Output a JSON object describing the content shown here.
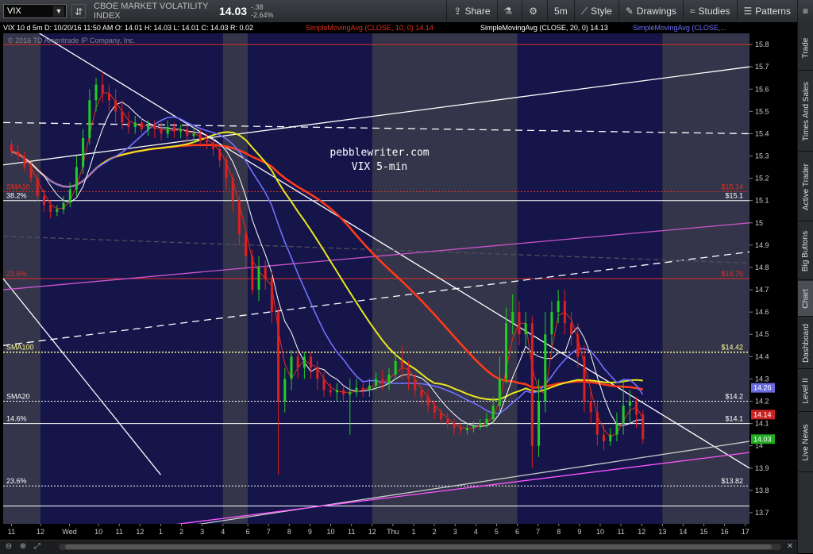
{
  "toolbar": {
    "symbol": "VIX",
    "company": "CBOE MARKET VOLATILITY INDEX",
    "price": "14.03",
    "change": "-.38",
    "change_pct": "-2.64%",
    "share": "Share",
    "timeframe": "5m",
    "style": "Style",
    "drawings": "Drawings",
    "studies": "Studies",
    "patterns": "Patterns"
  },
  "sidebar": {
    "tabs": [
      "Trade",
      "Times And Sales",
      "Active Trader",
      "Big Buttons",
      "Chart",
      "Dashboard",
      "Level II",
      "Live News"
    ]
  },
  "chart_data": {
    "type": "candlestick",
    "header_readout": "VIX 10 d 5m   D: 10/20/16 11:50 AM  O: 14.01  H: 14.03  L: 14.01  C: 14.03  R: 0.02",
    "copyright": "© 2016 TD Ameritrade IP Company, Inc.",
    "legend": [
      {
        "name": "SimpleMovingAvg (CLOSE, 10, 0)",
        "value": "14.14",
        "color": "#e03020"
      },
      {
        "name": "SimpleMovingAvg (CLOSE, 20, 0)",
        "value": "14.13",
        "color": "#ffffff"
      },
      {
        "name": "SimpleMovingAvg (CLOSE,...",
        "value": "",
        "color": "#7070ff"
      }
    ],
    "ylim": [
      13.65,
      15.9
    ],
    "yticks": [
      13.7,
      13.8,
      13.9,
      14.0,
      14.1,
      14.2,
      14.3,
      14.4,
      14.5,
      14.6,
      14.7,
      14.8,
      14.9,
      15.0,
      15.1,
      15.2,
      15.3,
      15.4,
      15.5,
      15.6,
      15.7,
      15.8
    ],
    "ytick_labels": [
      "13.7",
      "13.8",
      "13.9",
      "14",
      "14.1",
      "14.2",
      "14.3",
      "14.4",
      "14.5",
      "14.6",
      "14.7",
      "14.8",
      "14.9",
      "15",
      "15.1",
      "15.2",
      "15.3",
      "15.4",
      "15.5",
      "15.6",
      "15.7",
      "15.8"
    ],
    "x_range": [
      0,
      180
    ],
    "xticks": [
      {
        "x": 2,
        "label": "11"
      },
      {
        "x": 9,
        "label": "12"
      },
      {
        "x": 16,
        "label": "Wed"
      },
      {
        "x": 23,
        "label": "10"
      },
      {
        "x": 28,
        "label": "11"
      },
      {
        "x": 33,
        "label": "12"
      },
      {
        "x": 38,
        "label": "1"
      },
      {
        "x": 43,
        "label": "2"
      },
      {
        "x": 48,
        "label": "3"
      },
      {
        "x": 53,
        "label": "4"
      },
      {
        "x": 59,
        "label": "6"
      },
      {
        "x": 64,
        "label": "7"
      },
      {
        "x": 69,
        "label": "8"
      },
      {
        "x": 74,
        "label": "9"
      },
      {
        "x": 79,
        "label": "10"
      },
      {
        "x": 84,
        "label": "11"
      },
      {
        "x": 89,
        "label": "12"
      },
      {
        "x": 94,
        "label": "Thu"
      },
      {
        "x": 99,
        "label": "1"
      },
      {
        "x": 104,
        "label": "2"
      },
      {
        "x": 109,
        "label": "3"
      },
      {
        "x": 114,
        "label": "4"
      },
      {
        "x": 119,
        "label": "5"
      },
      {
        "x": 124,
        "label": "6"
      },
      {
        "x": 129,
        "label": "7"
      },
      {
        "x": 134,
        "label": "8"
      },
      {
        "x": 139,
        "label": "9"
      },
      {
        "x": 144,
        "label": "10"
      },
      {
        "x": 149,
        "label": "11"
      },
      {
        "x": 154,
        "label": "12"
      },
      {
        "x": 159,
        "label": "13"
      },
      {
        "x": 164,
        "label": "14"
      },
      {
        "x": 169,
        "label": "15"
      },
      {
        "x": 174,
        "label": "16"
      },
      {
        "x": 179,
        "label": "17"
      }
    ],
    "sessions": [
      {
        "from": 0,
        "to": 9,
        "shade": "light"
      },
      {
        "from": 9,
        "to": 53,
        "shade": "dark"
      },
      {
        "from": 53,
        "to": 59,
        "shade": "light"
      },
      {
        "from": 59,
        "to": 89,
        "shade": "dark"
      },
      {
        "from": 89,
        "to": 124,
        "shade": "light"
      },
      {
        "from": 124,
        "to": 159,
        "shade": "dark"
      },
      {
        "from": 159,
        "to": 180,
        "shade": "light"
      }
    ],
    "annotation": [
      "pebblewriter.com",
      "VIX 5-min"
    ],
    "hlines": [
      {
        "y": 15.8,
        "color": "#e03020",
        "style": "solid",
        "label": "",
        "price_label": ""
      },
      {
        "y": 15.14,
        "color": "#e03020",
        "style": "dotted",
        "label": "SMA10",
        "price_label": "$15.14"
      },
      {
        "y": 15.1,
        "color": "#ffffff",
        "style": "solid",
        "label": "38.2%",
        "price_label": "$15.1"
      },
      {
        "y": 14.75,
        "color": "#e03020",
        "style": "solid",
        "label": "23.6%",
        "price_label": "$14.75"
      },
      {
        "y": 14.42,
        "color": "#ffff99",
        "style": "dotted",
        "label": "SMA100",
        "price_label": "$14.42"
      },
      {
        "y": 14.2,
        "color": "#ffffff",
        "style": "dotted",
        "label": "SMA20",
        "price_label": "$14.2"
      },
      {
        "y": 14.1,
        "color": "#ffffff",
        "style": "solid",
        "label": "14.6%",
        "price_label": "$14.1"
      },
      {
        "y": 13.82,
        "color": "#ffffff",
        "style": "dotted",
        "label": "23.6%",
        "price_label": "$13.82"
      },
      {
        "y": 13.73,
        "color": "#ffffff",
        "style": "solid",
        "label": "",
        "price_label": ""
      }
    ],
    "trendlines": [
      {
        "x1": 0,
        "y1": 15.95,
        "x2": 180,
        "y2": 13.9,
        "color": "#ffffff",
        "dash": ""
      },
      {
        "x1": 0,
        "y1": 14.75,
        "x2": 38,
        "y2": 13.87,
        "color": "#ffffff",
        "dash": ""
      },
      {
        "x1": 0,
        "y1": 15.26,
        "x2": 180,
        "y2": 15.7,
        "color": "#ffffff",
        "dash": ""
      },
      {
        "x1": 0,
        "y1": 15.45,
        "x2": 180,
        "y2": 15.4,
        "color": "#ffffff",
        "dash": "9,6"
      },
      {
        "x1": 0,
        "y1": 14.45,
        "x2": 180,
        "y2": 14.87,
        "color": "#ffffff",
        "dash": "9,6"
      },
      {
        "x1": 0,
        "y1": 14.94,
        "x2": 180,
        "y2": 14.82,
        "color": "#505060",
        "dash": "6,4"
      },
      {
        "x1": 0,
        "y1": 14.7,
        "x2": 180,
        "y2": 15.0,
        "color": "#cc55cc",
        "dash": ""
      },
      {
        "x1": 30,
        "y1": 13.6,
        "x2": 180,
        "y2": 14.02,
        "color": "#cccccc",
        "dash": ""
      },
      {
        "x1": 34,
        "y1": 13.63,
        "x2": 180,
        "y2": 13.97,
        "color": "#ff55ff",
        "dash": ""
      }
    ],
    "candles": [
      [
        0,
        15.35,
        15.32,
        15.37,
        15.3
      ],
      [
        1,
        15.32,
        15.3,
        15.35,
        15.28
      ],
      [
        2,
        15.3,
        15.25,
        15.32,
        15.23
      ],
      [
        3,
        15.25,
        15.2,
        15.27,
        15.18
      ],
      [
        4,
        15.2,
        15.12,
        15.22,
        15.1
      ],
      [
        5,
        15.12,
        15.08,
        15.15,
        15.05
      ],
      [
        6,
        15.08,
        15.05,
        15.1,
        15.02
      ],
      [
        7,
        15.05,
        15.06,
        15.08,
        15.03
      ],
      [
        8,
        15.06,
        15.09,
        15.12,
        15.04
      ],
      [
        9,
        15.09,
        15.15,
        15.18,
        15.07
      ],
      [
        10,
        15.15,
        15.25,
        15.3,
        15.12
      ],
      [
        11,
        15.25,
        15.38,
        15.42,
        15.22
      ],
      [
        12,
        15.38,
        15.55,
        15.6,
        15.35
      ],
      [
        13,
        15.55,
        15.62,
        15.65,
        15.5
      ],
      [
        14,
        15.62,
        15.58,
        15.68,
        15.54
      ],
      [
        15,
        15.58,
        15.55,
        15.62,
        15.5
      ],
      [
        16,
        15.55,
        15.5,
        15.6,
        15.45
      ],
      [
        17,
        15.5,
        15.45,
        15.55,
        15.42
      ],
      [
        18,
        15.45,
        15.43,
        15.5,
        15.4
      ],
      [
        19,
        15.43,
        15.45,
        15.48,
        15.4
      ],
      [
        20,
        15.45,
        15.42,
        15.47,
        15.4
      ],
      [
        21,
        15.42,
        15.44,
        15.46,
        15.39
      ],
      [
        22,
        15.44,
        15.42,
        15.46,
        15.38
      ],
      [
        23,
        15.42,
        15.4,
        15.45,
        15.37
      ],
      [
        24,
        15.4,
        15.43,
        15.46,
        15.38
      ],
      [
        25,
        15.43,
        15.41,
        15.45,
        15.38
      ],
      [
        26,
        15.41,
        15.42,
        15.44,
        15.38
      ],
      [
        27,
        15.42,
        15.39,
        15.44,
        15.36
      ],
      [
        28,
        15.39,
        15.4,
        15.43,
        15.36
      ],
      [
        29,
        15.4,
        15.37,
        15.42,
        15.34
      ],
      [
        30,
        15.37,
        15.36,
        15.4,
        15.33
      ],
      [
        31,
        15.36,
        15.33,
        15.38,
        15.3
      ],
      [
        32,
        15.33,
        15.28,
        15.35,
        15.25
      ],
      [
        33,
        15.28,
        15.2,
        15.3,
        15.15
      ],
      [
        34,
        15.2,
        15.1,
        15.22,
        15.05
      ],
      [
        35,
        15.1,
        14.95,
        15.12,
        14.9
      ],
      [
        36,
        14.95,
        14.85,
        14.98,
        14.8
      ],
      [
        37,
        14.85,
        14.7,
        14.88,
        14.68
      ],
      [
        38,
        14.7,
        14.8,
        14.85,
        14.65
      ],
      [
        39,
        14.8,
        14.75,
        14.83,
        14.7
      ],
      [
        40,
        14.75,
        14.6,
        14.78,
        14.55
      ],
      [
        41,
        14.6,
        14.2,
        14.62,
        13.87
      ],
      [
        42,
        14.2,
        14.3,
        14.35,
        14.15
      ],
      [
        43,
        14.3,
        14.4,
        14.43,
        14.25
      ],
      [
        44,
        14.4,
        14.35,
        14.43,
        14.3
      ],
      [
        45,
        14.35,
        14.4,
        14.42,
        14.3
      ],
      [
        46,
        14.4,
        14.35,
        14.42,
        14.3
      ],
      [
        47,
        14.35,
        14.3,
        14.38,
        14.25
      ],
      [
        48,
        14.3,
        14.25,
        14.33,
        14.22
      ],
      [
        49,
        14.25,
        14.24,
        14.28,
        14.22
      ],
      [
        50,
        14.24,
        14.25,
        14.28,
        14.2
      ],
      [
        51,
        14.25,
        14.23,
        14.27,
        14.2
      ],
      [
        52,
        14.23,
        14.24,
        14.3,
        14.05
      ],
      [
        53,
        14.24,
        14.26,
        14.3,
        14.22
      ],
      [
        54,
        14.26,
        14.25,
        14.28,
        14.22
      ],
      [
        55,
        14.25,
        14.27,
        14.3,
        14.22
      ],
      [
        56,
        14.27,
        14.3,
        14.33,
        14.25
      ],
      [
        57,
        14.3,
        14.28,
        14.34,
        14.25
      ],
      [
        58,
        14.28,
        14.32,
        14.35,
        14.25
      ],
      [
        59,
        14.32,
        14.38,
        14.42,
        14.3
      ],
      [
        60,
        14.38,
        14.35,
        14.45,
        14.3
      ],
      [
        61,
        14.35,
        14.3,
        14.38,
        14.25
      ],
      [
        62,
        14.3,
        14.25,
        14.32,
        14.22
      ],
      [
        63,
        14.25,
        14.22,
        14.27,
        14.18
      ],
      [
        64,
        14.22,
        14.18,
        14.25,
        14.15
      ],
      [
        65,
        14.18,
        14.15,
        14.2,
        14.12
      ],
      [
        66,
        14.15,
        14.12,
        14.17,
        14.1
      ],
      [
        67,
        14.12,
        14.1,
        14.15,
        14.08
      ],
      [
        68,
        14.1,
        14.08,
        14.12,
        14.05
      ],
      [
        69,
        14.08,
        14.07,
        14.1,
        14.05
      ],
      [
        70,
        14.07,
        14.08,
        14.1,
        14.05
      ],
      [
        71,
        14.08,
        14.09,
        14.11,
        14.06
      ],
      [
        72,
        14.09,
        14.1,
        14.12,
        14.07
      ],
      [
        73,
        14.1,
        14.12,
        14.15,
        14.08
      ],
      [
        74,
        14.12,
        14.18,
        14.22,
        14.1
      ],
      [
        75,
        14.18,
        14.3,
        14.4,
        14.15
      ],
      [
        76,
        14.3,
        14.55,
        14.62,
        14.28
      ],
      [
        77,
        14.55,
        14.6,
        14.68,
        14.5
      ],
      [
        78,
        14.6,
        14.5,
        14.65,
        14.45
      ],
      [
        79,
        14.5,
        14.55,
        14.6,
        14.45
      ],
      [
        80,
        14.55,
        14.0,
        14.58,
        13.9
      ],
      [
        81,
        14.0,
        14.2,
        14.3,
        13.95
      ],
      [
        82,
        14.2,
        14.5,
        14.6,
        14.15
      ],
      [
        83,
        14.5,
        14.6,
        14.65,
        14.45
      ],
      [
        84,
        14.6,
        14.65,
        14.7,
        14.55
      ],
      [
        85,
        14.65,
        14.55,
        14.7,
        14.5
      ],
      [
        86,
        14.55,
        14.5,
        14.6,
        14.45
      ],
      [
        87,
        14.5,
        14.4,
        14.55,
        14.35
      ],
      [
        88,
        14.4,
        14.2,
        14.45,
        14.15
      ],
      [
        89,
        14.2,
        14.15,
        14.25,
        14.1
      ],
      [
        90,
        14.15,
        14.05,
        14.2,
        14.0
      ],
      [
        91,
        14.05,
        14.02,
        14.1,
        13.98
      ],
      [
        92,
        14.02,
        14.05,
        14.08,
        14.0
      ],
      [
        93,
        14.05,
        14.1,
        14.15,
        14.02
      ],
      [
        94,
        14.1,
        14.18,
        14.3,
        14.05
      ],
      [
        95,
        14.18,
        14.2,
        14.25,
        14.1
      ],
      [
        96,
        14.2,
        14.14,
        14.22,
        14.08
      ],
      [
        97,
        14.14,
        14.03,
        14.16,
        14.01
      ]
    ]
  },
  "price_tags": [
    {
      "value": "14.26",
      "y": 14.26,
      "bg": "#6a6ae0",
      "fg": "#ffffff"
    },
    {
      "value": "14.14",
      "y": 14.14,
      "bg": "#cc2222",
      "fg": "#ffffff"
    },
    {
      "value": "14.03",
      "y": 14.03,
      "bg": "#22aa22",
      "fg": "#ffffff"
    }
  ]
}
